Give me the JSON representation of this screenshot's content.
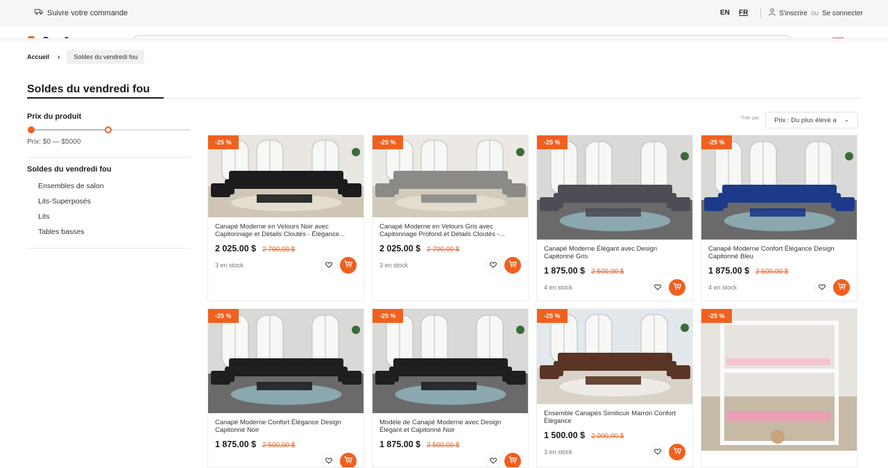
{
  "topbar": {
    "track_order": "Suivre votre commande",
    "lang_en": "EN",
    "lang_fr": "FR",
    "signup": "S'inscrire",
    "or": "ou",
    "login": "Se connecter"
  },
  "breadcrumb": {
    "home": "Accueil",
    "separator": "›",
    "current": "Soldes du vendredi fou"
  },
  "page": {
    "title": "Soldes du vendredi fou"
  },
  "filters": {
    "price_title": "Prix du produit",
    "price_range": "Prix: $0 — $5000",
    "category_title": "Soldes du vendredi fou",
    "categories": [
      "Ensembles de salon",
      "Lits-Superposés",
      "Lits",
      "Tables basses"
    ]
  },
  "sort": {
    "label": "Trier par",
    "value": "Prix : Du plus élevé a",
    "chevron": "⌄"
  },
  "products": [
    {
      "badge": "-25 %",
      "name": "Canapé Moderne en Velours Noir avec Capitonnage et Détails Cloutés - Élégance...",
      "price": "2 025.00 $",
      "old_price": "2 700,00 $",
      "stock": "3 en stock",
      "image": "black-velvet-sofa-set"
    },
    {
      "badge": "-25 %",
      "name": "Canapé Moderne en Velours Gris avec Capitonnage Profond et Détails Cloutés -...",
      "price": "2 025.00 $",
      "old_price": "2 700,00 $",
      "stock": "3 en stock",
      "image": "grey-velvet-sofa-set"
    },
    {
      "badge": "-25 %",
      "name": "Canapé Moderne Élégant avec Design Capitonné Gris",
      "price": "1 875.00 $",
      "old_price": "2 500,00 $",
      "stock": "4 en stock",
      "image": "grey-tufted-sofa-set"
    },
    {
      "badge": "-25 %",
      "name": "Canapé Moderne Confort Élégance Design Capitonné Bleu",
      "price": "1 875.00 $",
      "old_price": "2 500,00 $",
      "stock": "4 en stock",
      "image": "blue-tufted-sofa-set"
    },
    {
      "badge": "-25 %",
      "name": "Canapé Moderne Confort Élégance Design Capitonné Noir",
      "price": "1 875.00 $",
      "old_price": "2 500,00 $",
      "stock": "",
      "image": "black-tufted-sofa-set"
    },
    {
      "badge": "-25 %",
      "name": "Modèle de Canapé Moderne avec Design Élégant et Capitonné Noir",
      "price": "1 875.00 $",
      "old_price": "2 500,00 $",
      "stock": "",
      "image": "black-tufted-sofa-set-2"
    },
    {
      "badge": "-25 %",
      "name": "Ensemble Canapés Similicuir Marron Confort Élégance",
      "price": "1 500.00 $",
      "old_price": "2 000,00 $",
      "stock": "3 en stock",
      "image": "brown-leather-sofa-set"
    },
    {
      "badge": "-25 %",
      "name": "",
      "price": "",
      "old_price": "",
      "stock": "",
      "image": "white-bunk-bed"
    }
  ],
  "colors": {
    "accent": "#f0601f",
    "text": "#1a1a1a",
    "muted": "#777777"
  }
}
